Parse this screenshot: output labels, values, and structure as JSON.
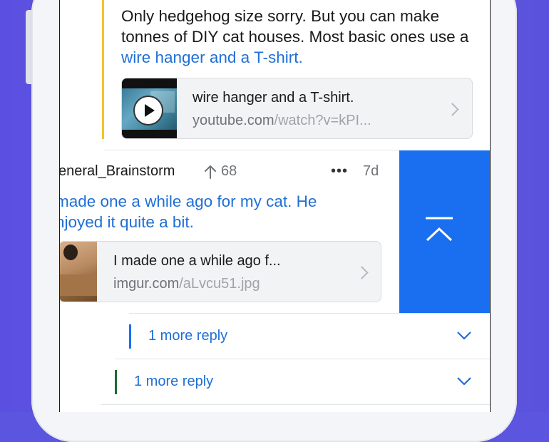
{
  "colors": {
    "accent_blue": "#1f6fd6",
    "swipe_blue": "#1a6ff0",
    "quote_bar_yellow": "#f6c32a",
    "thread_bar_blue": "#1a6ff0",
    "thread_bar_green": "#1e6b2f"
  },
  "parent_comment": {
    "text_before_link": "Only hedgehog size sorry. But you can make tonnes of DIY cat houses. Most basic ones use a ",
    "link_text": "wire hanger and a T-shirt.",
    "preview": {
      "title": "wire hanger and a T-shirt.",
      "url_domain": "youtube.com",
      "url_path": "/watch?v=kPI...",
      "thumb_icon": "play-icon",
      "chevron_icon": "chevron-right-icon"
    }
  },
  "reply_comment": {
    "author": "eneral_Brainstorm",
    "upvote_icon": "upvote-arrow-icon",
    "score": "68",
    "more_icon": "more-dots-icon",
    "more_glyph": "•••",
    "age": "7d",
    "text": "made one a while ago for my cat. He njoyed it quite a bit.",
    "text_line1": "made one a while ago for my cat. He",
    "text_line2": "njoyed it quite a bit.",
    "preview": {
      "title": "I made one a while ago f...",
      "url_domain": "imgur.com",
      "url_path": "/aLvcu51.jpg",
      "chevron_icon": "chevron-right-icon"
    }
  },
  "swipe_action": {
    "icon": "collapse-thread-icon"
  },
  "more_replies": [
    {
      "label": "1 more reply",
      "bar_color": "#1a6ff0",
      "chevron_icon": "chevron-down-icon"
    },
    {
      "label": "1 more reply",
      "bar_color": "#1e6b2f",
      "chevron_icon": "chevron-down-icon"
    }
  ]
}
